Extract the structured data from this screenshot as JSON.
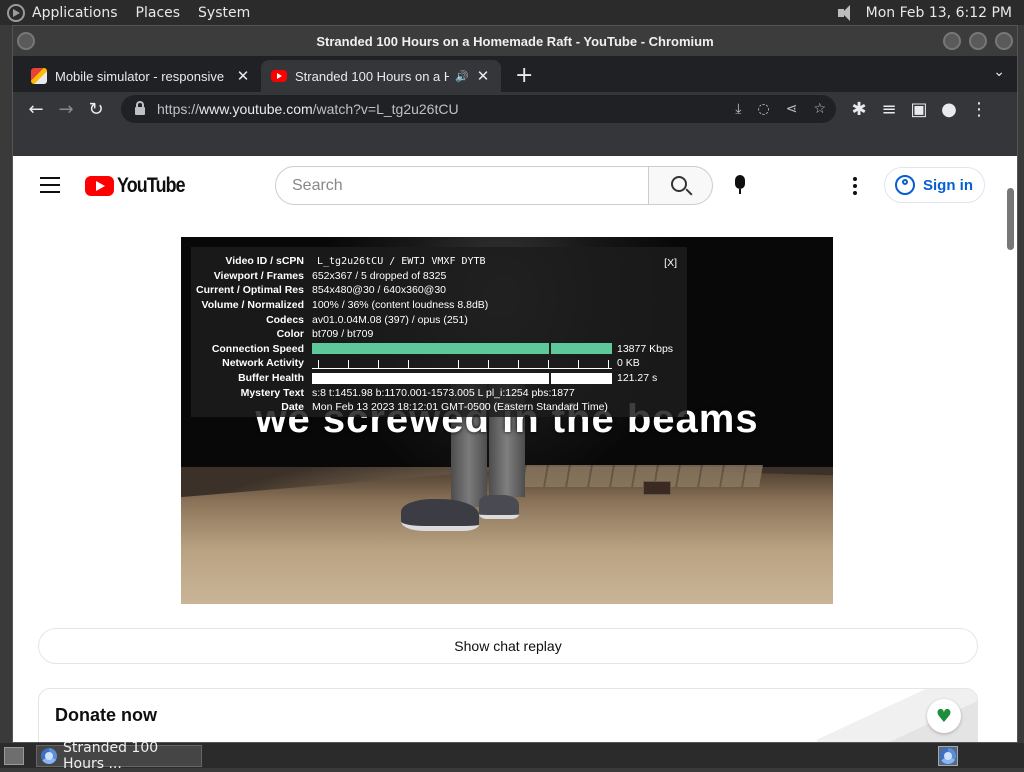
{
  "top_panel": {
    "menus": [
      "Applications",
      "Places",
      "System"
    ],
    "clock": "Mon Feb 13,  6:12 PM"
  },
  "window": {
    "title": "Stranded 100 Hours on a Homemade Raft - YouTube - Chromium"
  },
  "tabs": [
    {
      "title": "Mobile simulator - responsive",
      "favicon": "simulator-icon",
      "active": false
    },
    {
      "title": "Stranded 100 Hours on a H",
      "favicon": "youtube-icon",
      "active": true,
      "audio_icon": "🔊"
    }
  ],
  "toolbar": {
    "url_prefix": "https://",
    "url_host": "www.youtube.com",
    "url_path": "/watch?v=L_tg2u26tCU"
  },
  "youtube": {
    "logo_text": "YouTube",
    "search_placeholder": "Search",
    "signin_label": "Sign in"
  },
  "video": {
    "caption": "we screwed in the beams",
    "stats_close": "[X]",
    "stats": [
      {
        "label": "Video ID / sCPN",
        "value": "L_tg2u26tCU / EWTJ VMXF DYTB"
      },
      {
        "label": "Viewport / Frames",
        "value": "652x367 / 5 dropped of 8325"
      },
      {
        "label": "Current / Optimal Res",
        "value": "854x480@30 / 640x360@30"
      },
      {
        "label": "Volume / Normalized",
        "value": "100% / 36% (content loudness 8.8dB)"
      },
      {
        "label": "Codecs",
        "value": "av01.0.04M.08 (397) / opus (251)"
      },
      {
        "label": "Color",
        "value": "bt709 / bt709"
      },
      {
        "label": "Connection Speed",
        "value": "13877 Kbps"
      },
      {
        "label": "Network Activity",
        "value": "0 KB"
      },
      {
        "label": "Buffer Health",
        "value": "121.27 s"
      },
      {
        "label": "Mystery Text",
        "value": "s:8 t:1451.98 b:1170.001-1573.005 L pl_i:1254 pbs:1877"
      },
      {
        "label": "Date",
        "value": "Mon Feb 13 2023 18:12:01 GMT-0500 (Eastern Standard Time)"
      }
    ]
  },
  "chat_replay_label": "Show chat replay",
  "donate_title": "Donate now",
  "taskbar": {
    "window_button": "Stranded 100 Hours ..."
  }
}
